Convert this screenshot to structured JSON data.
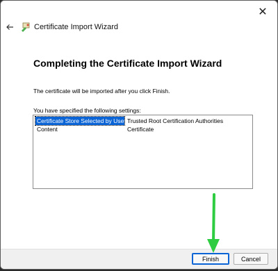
{
  "window": {
    "title": "Certificate Import Wizard",
    "close_glyph": "✕"
  },
  "icons": {
    "back": "back-arrow-icon",
    "wizard": "certificate-wizard-icon",
    "close": "close-icon"
  },
  "page": {
    "heading": "Completing the Certificate Import Wizard",
    "description": "The certificate will be imported after you click Finish.",
    "settings_label": "You have specified the following settings:"
  },
  "settings": [
    {
      "key": "Certificate Store Selected by User",
      "value": "Trusted Root Certification Authorities"
    },
    {
      "key": "Content",
      "value": "Certificate"
    }
  ],
  "buttons": {
    "finish": "Finish",
    "cancel": "Cancel"
  },
  "colors": {
    "accent": "#0a64d6",
    "annotation_arrow": "#2ecc40"
  }
}
